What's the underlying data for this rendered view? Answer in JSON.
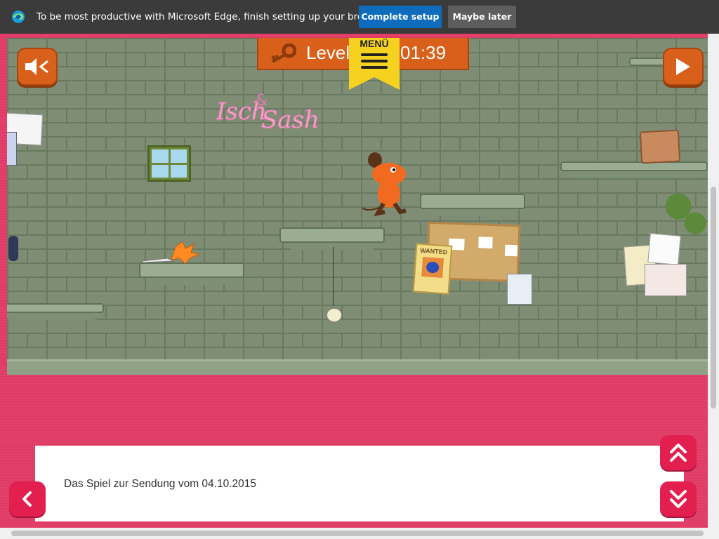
{
  "edge_bar": {
    "message": "To be most productive with Microsoft Edge, finish setting up your browser.",
    "complete_label": "Complete setup",
    "later_label": "Maybe later"
  },
  "game": {
    "level_label": "Level",
    "timer": "01:39",
    "menu_label": "MENÜ",
    "graffiti_text": "Isch & Sash",
    "poster_text": "WANTED"
  },
  "info": {
    "description": "Das Spiel zur Sendung vom 04.10.2015"
  },
  "colors": {
    "accent_orange": "#d9601a",
    "page_pink": "#e2426b",
    "button_pink": "#e21f4f",
    "menu_yellow": "#f4d21f",
    "edge_blue": "#0f6cbd"
  },
  "icons": {
    "sound": "speaker-muted-icon",
    "next": "play-icon",
    "menu": "hamburger-icon",
    "key": "key-icon",
    "back": "chevron-left-icon",
    "up": "double-chevron-up-icon",
    "down": "double-chevron-down-icon"
  }
}
